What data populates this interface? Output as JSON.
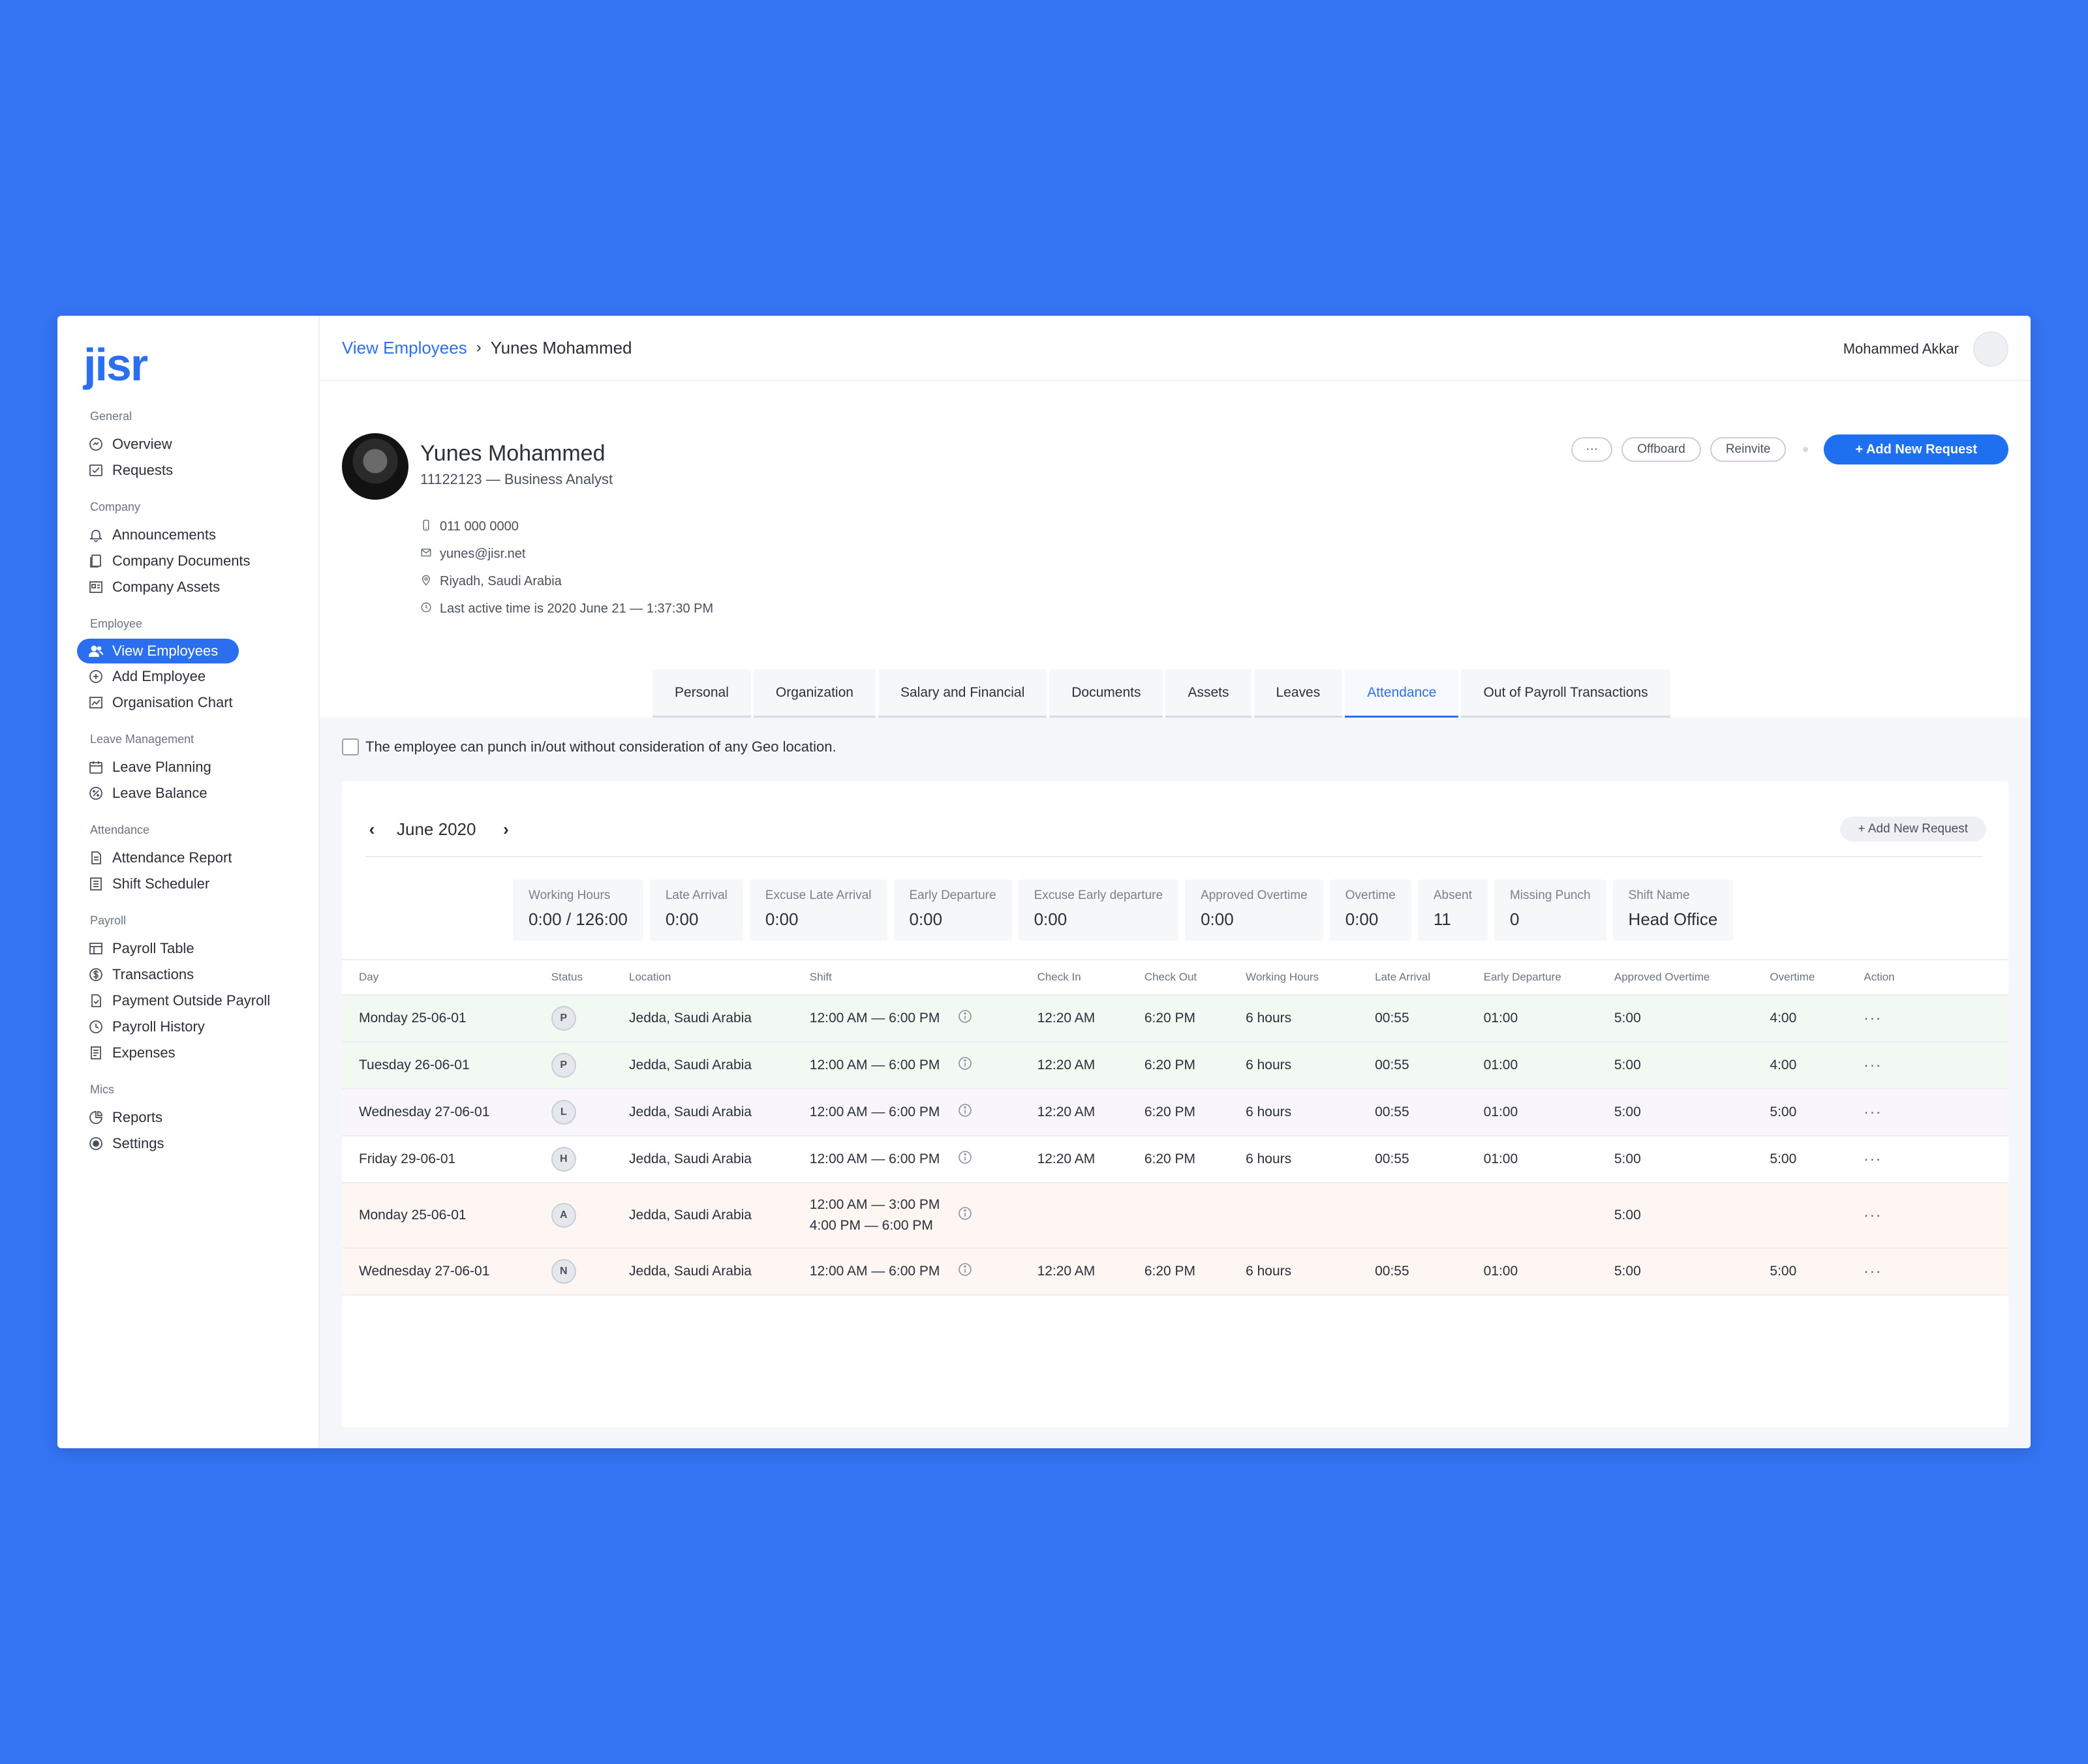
{
  "logo": "jisr",
  "sidebar": {
    "sections": [
      {
        "title": "General",
        "items": [
          {
            "label": "Overview",
            "icon": "overview-icon"
          },
          {
            "label": "Requests",
            "icon": "requests-icon"
          }
        ]
      },
      {
        "title": "Company",
        "items": [
          {
            "label": "Announcements",
            "icon": "bell-icon"
          },
          {
            "label": "Company Documents",
            "icon": "documents-icon"
          },
          {
            "label": "Company Assets",
            "icon": "assets-icon"
          }
        ]
      },
      {
        "title": "Employee",
        "items": [
          {
            "label": "View Employees",
            "icon": "users-icon",
            "active": true
          },
          {
            "label": "Add Employee",
            "icon": "plus-circle-icon"
          },
          {
            "label": "Organisation Chart",
            "icon": "chart-icon"
          }
        ]
      },
      {
        "title": "Leave Management",
        "items": [
          {
            "label": "Leave Planning",
            "icon": "calendar-icon"
          },
          {
            "label": "Leave Balance",
            "icon": "percent-icon"
          }
        ]
      },
      {
        "title": "Attendance",
        "items": [
          {
            "label": "Attendance Report",
            "icon": "report-icon"
          },
          {
            "label": "Shift Scheduler",
            "icon": "scheduler-icon"
          }
        ]
      },
      {
        "title": "Payroll",
        "items": [
          {
            "label": "Payroll Table",
            "icon": "table-icon"
          },
          {
            "label": "Transactions",
            "icon": "dollar-icon"
          },
          {
            "label": "Payment Outside Payroll",
            "icon": "payment-icon"
          },
          {
            "label": "Payroll History",
            "icon": "history-icon"
          },
          {
            "label": "Expenses",
            "icon": "expenses-icon"
          }
        ]
      },
      {
        "title": "Mics",
        "items": [
          {
            "label": "Reports",
            "icon": "pie-icon"
          },
          {
            "label": "Settings",
            "icon": "settings-icon"
          }
        ]
      }
    ]
  },
  "breadcrumb": {
    "link": "View Employees",
    "current": "Yunes Mohammed"
  },
  "user": {
    "name": "Mohammed Akkar"
  },
  "profile": {
    "name": "Yunes Mohammed",
    "subtitle": "11122123 — Business Analyst",
    "phone": "011 000 0000",
    "email": "yunes@jisr.net",
    "location": "Riyadh, Saudi Arabia",
    "last_active": "Last active time is 2020 June 21 — 1:37:30 PM"
  },
  "actions": {
    "more": "···",
    "offboard": "Offboard",
    "reinvite": "Reinvite",
    "add_request": "+ Add New Request"
  },
  "tabs": [
    "Personal",
    "Organization",
    "Salary and Financial",
    "Documents",
    "Assets",
    "Leaves",
    "Attendance",
    "Out of Payroll Transactions"
  ],
  "active_tab": "Attendance",
  "geo_checkbox": "The employee can punch in/out without consideration of any Geo location.",
  "calendar": {
    "month": "June 2020",
    "add_request": "+ Add New Request"
  },
  "stats": [
    {
      "label": "Working Hours",
      "value": "0:00 / 126:00"
    },
    {
      "label": "Late Arrival",
      "value": "0:00"
    },
    {
      "label": "Excuse Late Arrival",
      "value": "0:00"
    },
    {
      "label": "Early Departure",
      "value": "0:00"
    },
    {
      "label": "Excuse Early departure",
      "value": "0:00"
    },
    {
      "label": "Approved Overtime",
      "value": "0:00"
    },
    {
      "label": "Overtime",
      "value": "0:00"
    },
    {
      "label": "Absent",
      "value": "11"
    },
    {
      "label": "Missing Punch",
      "value": "0"
    },
    {
      "label": "Shift Name",
      "value": "Head Office"
    }
  ],
  "table": {
    "headers": [
      "Day",
      "Status",
      "Location",
      "Shift",
      "Check In",
      "Check Out",
      "Working Hours",
      "Late Arrival",
      "Early Departure",
      "Approved Overtime",
      "Overtime",
      "Action"
    ],
    "rows": [
      {
        "day": "Monday  25-06-01",
        "status": "P",
        "location": "Jedda, Saudi Arabia",
        "shift": [
          "12:00 AM — 6:00 PM"
        ],
        "check_in": "12:20 AM",
        "check_out": "6:20 PM",
        "working_hours": "6 hours",
        "late_arrival": "00:55",
        "early_departure": "01:00",
        "approved_overtime": "5:00",
        "overtime": "4:00",
        "action": "···",
        "tone": "green"
      },
      {
        "day": "Tuesday  26-06-01",
        "status": "P",
        "location": "Jedda, Saudi Arabia",
        "shift": [
          "12:00 AM — 6:00 PM"
        ],
        "check_in": "12:20 AM",
        "check_out": "6:20 PM",
        "working_hours": "6 hours",
        "late_arrival": "00:55",
        "early_departure": "01:00",
        "approved_overtime": "5:00",
        "overtime": "4:00",
        "action": "···",
        "tone": "green"
      },
      {
        "day": "Wednesday  27-06-01",
        "status": "L",
        "location": "Jedda, Saudi Arabia",
        "shift": [
          "12:00 AM — 6:00 PM"
        ],
        "check_in": "12:20 AM",
        "check_out": "6:20 PM",
        "working_hours": "6 hours",
        "late_arrival": "00:55",
        "early_departure": "01:00",
        "approved_overtime": "5:00",
        "overtime": "5:00",
        "action": "···",
        "tone": "purple"
      },
      {
        "day": "Friday  29-06-01",
        "status": "H",
        "location": "Jedda, Saudi Arabia",
        "shift": [
          "12:00 AM — 6:00 PM"
        ],
        "check_in": "12:20 AM",
        "check_out": "6:20 PM",
        "working_hours": "6 hours",
        "late_arrival": "00:55",
        "early_departure": "01:00",
        "approved_overtime": "5:00",
        "overtime": "5:00",
        "action": "···",
        "tone": "white"
      },
      {
        "day": "Monday  25-06-01",
        "status": "A",
        "location": "Jedda, Saudi Arabia",
        "shift": [
          "12:00 AM — 3:00 PM",
          "4:00 PM — 6:00 PM"
        ],
        "check_in": "",
        "check_out": "",
        "working_hours": "",
        "late_arrival": "",
        "early_departure": "",
        "approved_overtime": "5:00",
        "overtime": "",
        "action": "···",
        "tone": "orange"
      },
      {
        "day": "Wednesday  27-06-01",
        "status": "N",
        "location": "Jedda, Saudi Arabia",
        "shift": [
          "12:00 AM — 6:00 PM"
        ],
        "check_in": "12:20 AM",
        "check_out": "6:20 PM",
        "working_hours": "6 hours",
        "late_arrival": "00:55",
        "early_departure": "01:00",
        "approved_overtime": "5:00",
        "overtime": "5:00",
        "action": "···",
        "tone": "orange"
      }
    ]
  },
  "colors": {
    "background": "#3473f2",
    "accent": "#2b6ff0",
    "primary_button": "#1f6ff1"
  }
}
